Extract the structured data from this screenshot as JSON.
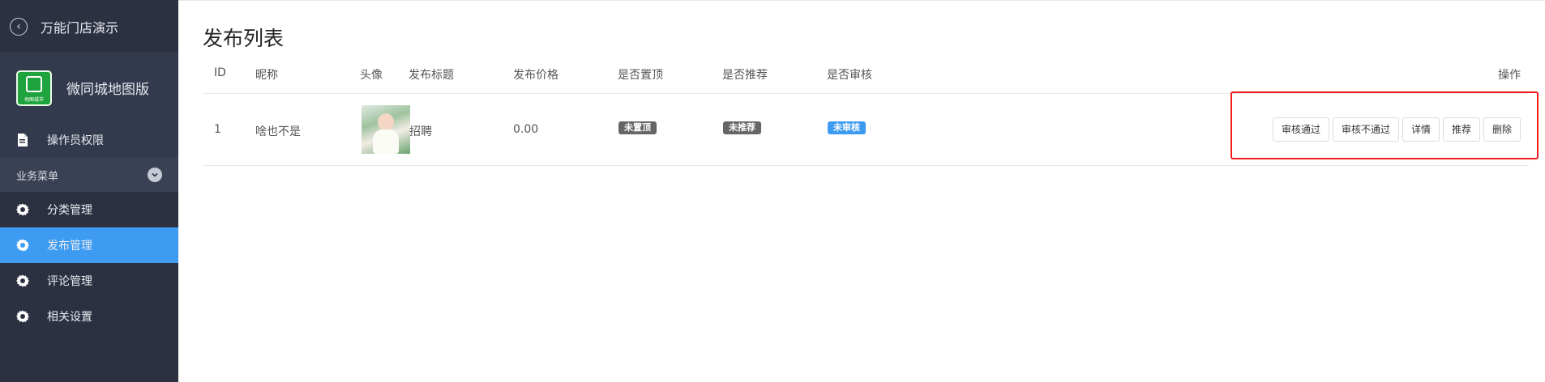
{
  "sidebar": {
    "app_title": "万能门店演示",
    "brand_name": "微同城地图版",
    "logo_caption": "地图城市",
    "perm_item": "操作员权限",
    "section_label": "业务菜单",
    "items": [
      {
        "label": "分类管理",
        "icon": "gear-icon"
      },
      {
        "label": "发布管理",
        "icon": "gear-icon"
      },
      {
        "label": "评论管理",
        "icon": "gear-icon"
      },
      {
        "label": "相关设置",
        "icon": "gear-icon"
      }
    ],
    "active_item": "发布管理",
    "colors": {
      "bg": "#2c3142",
      "active": "#3d9bf1"
    }
  },
  "main": {
    "title": "发布列表",
    "columns": {
      "id": "ID",
      "nickname": "昵称",
      "avatar": "头像",
      "post_title": "发布标题",
      "price": "发布价格",
      "is_top": "是否置顶",
      "is_recommend": "是否推荐",
      "is_approved": "是否审核",
      "actions": "操作"
    },
    "rows": [
      {
        "id": "1",
        "nickname": "啥也不是",
        "post_title": "招聘",
        "price": "0.00",
        "top_badge": "未置顶",
        "recommend_badge": "未推荐",
        "approve_badge": "未审核"
      }
    ],
    "action_buttons": {
      "approve": "审核通过",
      "reject": "审核不通过",
      "detail": "详情",
      "recommend": "推荐",
      "delete": "删除"
    },
    "colors": {
      "badge_gray": "#666666",
      "badge_blue": "#3d9bf1",
      "highlight": "#ee1c1c"
    }
  }
}
